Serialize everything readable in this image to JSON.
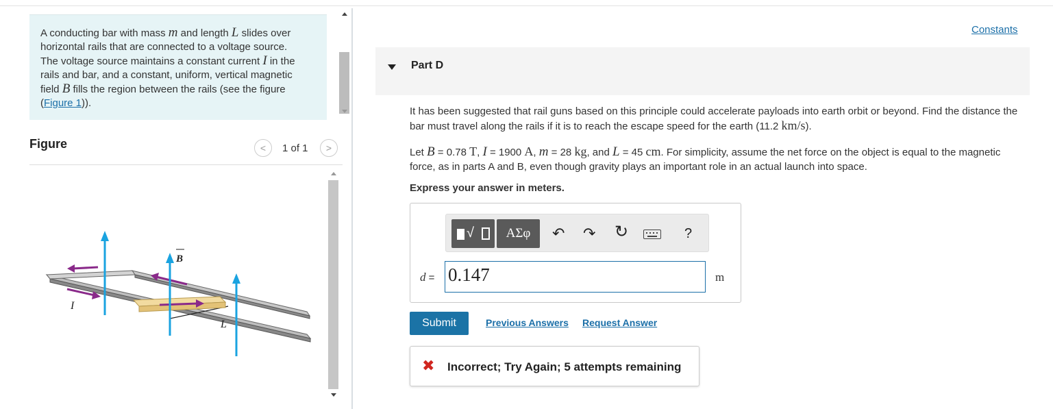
{
  "intro": {
    "line1_a": "A conducting bar with mass ",
    "m_var": "m",
    "line1_b": " and length ",
    "L_var": "L",
    "line1_c": " slides over horizontal rails that are connected to a voltage source. The voltage source maintains a constant current ",
    "I_var": "I",
    "line1_d": " in the rails and bar, and a constant, uniform, vertical magnetic field ",
    "B_var": "B",
    "line1_e": " fills the region between the rails (see the figure (",
    "figure_link": "Figure 1",
    "line1_f": "))."
  },
  "figure": {
    "title": "Figure",
    "prev": "<",
    "counter": "1 of 1",
    "next": ">",
    "labels": {
      "B": "B",
      "I": "I",
      "L": "L"
    }
  },
  "constants_link": "Constants",
  "part": {
    "title": "Part D"
  },
  "question": {
    "text_a": "It has been suggested that rail guns based on this principle could accelerate payloads into earth orbit or beyond. Find the distance the bar must travel along the rails if it is to reach the escape speed for the earth (11.2 ",
    "speed_unit": "km/s",
    "text_b": ")."
  },
  "given": {
    "let": "Let ",
    "B_var": "B",
    "B_eq": " = 0.78 ",
    "B_unit": "T",
    "sep1": ", ",
    "I_var": "I",
    "I_eq": " = 1900 ",
    "I_unit": "A",
    "sep2": ", ",
    "m_var": "m",
    "m_eq": " = 28 ",
    "m_unit": "kg",
    "sep3": ", and ",
    "L_var": "L",
    "L_eq": " = 45 ",
    "L_unit": "cm",
    "rest": ". For simplicity, assume the net force on the object is equal to the magnetic force, as in parts A and B, even though gravity plays an important role in an actual launch into space."
  },
  "instruction": "Express your answer in meters.",
  "toolbar": {
    "template_root": "√",
    "symbols_label": "ΑΣφ",
    "undo": "↶",
    "redo": "↷",
    "reset": "↻",
    "help": "?"
  },
  "answer": {
    "var": "d",
    "eq": " = ",
    "value": "0.147",
    "unit": "m"
  },
  "actions": {
    "submit": "Submit",
    "previous_answers": "Previous Answers",
    "request_answer": "Request Answer"
  },
  "feedback": {
    "icon": "✖",
    "text": "Incorrect; Try Again; 5 attempts remaining"
  },
  "colors": {
    "accent": "#1b73a6",
    "intro_bg": "#e6f4f6",
    "error": "#d0261f",
    "field_arrow": "#1aa3e0",
    "current_arrow": "#8a2a8a",
    "bar": "#f2dba0"
  }
}
